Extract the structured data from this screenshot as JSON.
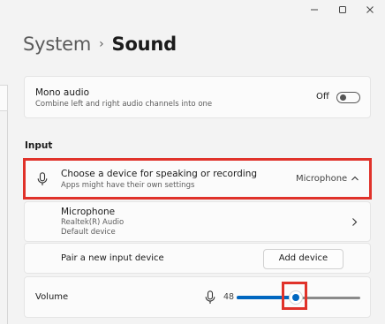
{
  "window": {
    "controls": {
      "minimize_icon": "minimize-icon",
      "maximize_icon": "maximize-icon",
      "close_icon": "close-icon"
    }
  },
  "breadcrumb": {
    "parent": "System",
    "separator": "›",
    "current": "Sound"
  },
  "mono_audio": {
    "title": "Mono audio",
    "description": "Combine left and right audio channels into one",
    "state_label": "Off",
    "toggle_on": false
  },
  "input_section": {
    "header": "Input",
    "chooser": {
      "title": "Choose a device for speaking or recording",
      "description": "Apps might have their own settings",
      "selected_device": "Microphone",
      "icon": "microphone-icon",
      "expanded": true
    },
    "device": {
      "name": "Microphone",
      "driver": "Realtek(R) Audio",
      "status": "Default device"
    },
    "pair": {
      "label": "Pair a new input device",
      "button_label": "Add device"
    }
  },
  "volume": {
    "label": "Volume",
    "value": "48",
    "level": 0.48,
    "icon": "microphone-icon"
  },
  "colors": {
    "accent": "#0067c0",
    "highlight": "#e0322a"
  }
}
